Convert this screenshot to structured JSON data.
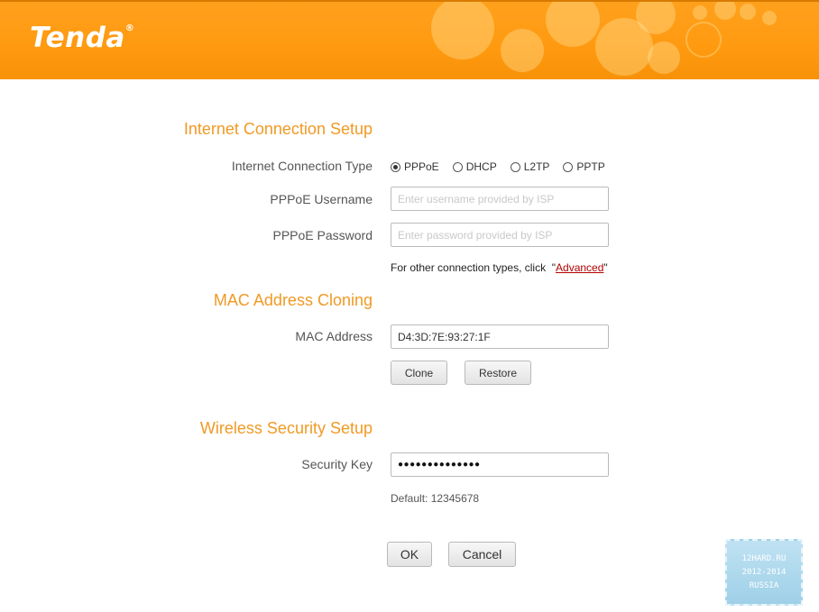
{
  "header": {
    "logo_text": "Tenda",
    "logo_mark": "®",
    "brand_color": "#ff9a10"
  },
  "internet": {
    "section_title": "Internet Connection Setup",
    "type_label": "Internet Connection Type",
    "types": [
      {
        "label": "PPPoE",
        "checked": true
      },
      {
        "label": "DHCP",
        "checked": false
      },
      {
        "label": "L2TP",
        "checked": false
      },
      {
        "label": "PPTP",
        "checked": false
      }
    ],
    "username_label": "PPPoE Username",
    "username_placeholder": "Enter username provided by ISP",
    "username_value": "",
    "password_label": "PPPoE Password",
    "password_placeholder": "Enter password provided by ISP",
    "password_value": "",
    "other_note_prefix": "For other connection types, click  \"",
    "advanced_link": "Advanced",
    "other_note_suffix": "\""
  },
  "mac": {
    "section_title": "MAC Address Cloning",
    "label": "MAC Address",
    "value": "D4:3D:7E:93:27:1F",
    "clone_button": "Clone",
    "restore_button": "Restore"
  },
  "wireless": {
    "section_title": "Wireless Security Setup",
    "key_label": "Security Key",
    "key_masked": "●●●●●●●●●●●●●●",
    "default_label": "Default: ",
    "default_value": "12345678"
  },
  "actions": {
    "ok_button": "OK",
    "cancel_button": "Cancel"
  },
  "watermark": {
    "line1": "12HARD.RU",
    "line2": "2012-2014",
    "line3": "RUSSIA"
  },
  "colors": {
    "section_title": "#f09a25",
    "link": "#b30000"
  }
}
